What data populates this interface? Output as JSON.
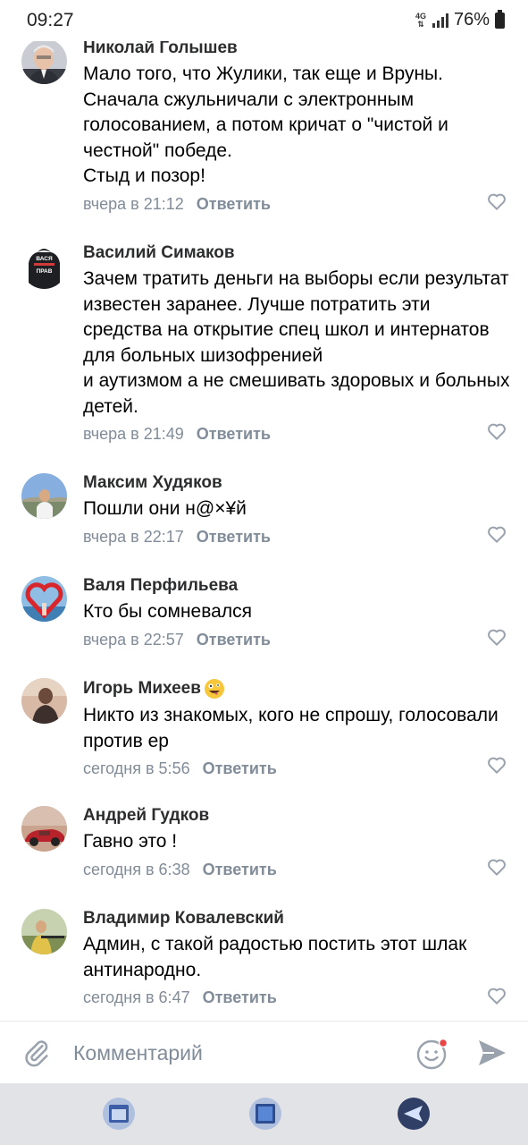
{
  "status": {
    "time": "09:27",
    "network": "4G",
    "battery": "76%"
  },
  "comments": [
    {
      "author": "Николай Голышев",
      "text": "Мало того, что Жулики, так еще и Вруны.\nСначала сжульничали с электронным голосованием, а потом кричат о \"чистой и честной\" победе.\nСтыд и позор!",
      "time": "вчера в 21:12",
      "reply": "Ответить"
    },
    {
      "author": "Василий Симаков",
      "text": "Зачем тратить деньги на выборы если результат известен заранее. Лучше потратить эти средства на открытие спец школ и интернатов для больных шизофренией\nи аутизмом а не смешивать здоровых и больных детей.",
      "time": "вчера в 21:49",
      "reply": "Ответить",
      "avatar_text": {
        "top": "ВАСЯ",
        "bottom": "ПРАВ"
      }
    },
    {
      "author": "Максим Худяков",
      "text": "Пошли они н@×¥й",
      "time": "вчера в 22:17",
      "reply": "Ответить"
    },
    {
      "author": "Валя Перфильева",
      "text": "Кто бы сомневался",
      "time": "вчера в 22:57",
      "reply": "Ответить"
    },
    {
      "author": "Игорь Михеев",
      "author_emoji": "zany-face-emoji",
      "text": "Никто из знакомых, кого не спрошу, голосовали против ер",
      "time": "сегодня в 5:56",
      "reply": "Ответить"
    },
    {
      "author": "Андрей Гудков",
      "text": "Гавно это !",
      "time": "сегодня в 6:38",
      "reply": "Ответить"
    },
    {
      "author": "Владимир Ковалевский",
      "text": "Админ, с такой радостью постить этот шлак антинародно.",
      "time": "сегодня в 6:47",
      "reply": "Ответить"
    }
  ],
  "composer": {
    "placeholder": "Комментарий"
  },
  "icons": {
    "attach": "paperclip-icon",
    "sticker": "smile-icon",
    "send": "send-icon",
    "like": "heart-icon",
    "nav": [
      "recent-apps-icon",
      "home-icon",
      "back-icon"
    ]
  },
  "colors": {
    "meta": "#818c99",
    "like": "#99a2ad",
    "notification_dot": "#e64646",
    "navbar": "#e2e3e6"
  }
}
